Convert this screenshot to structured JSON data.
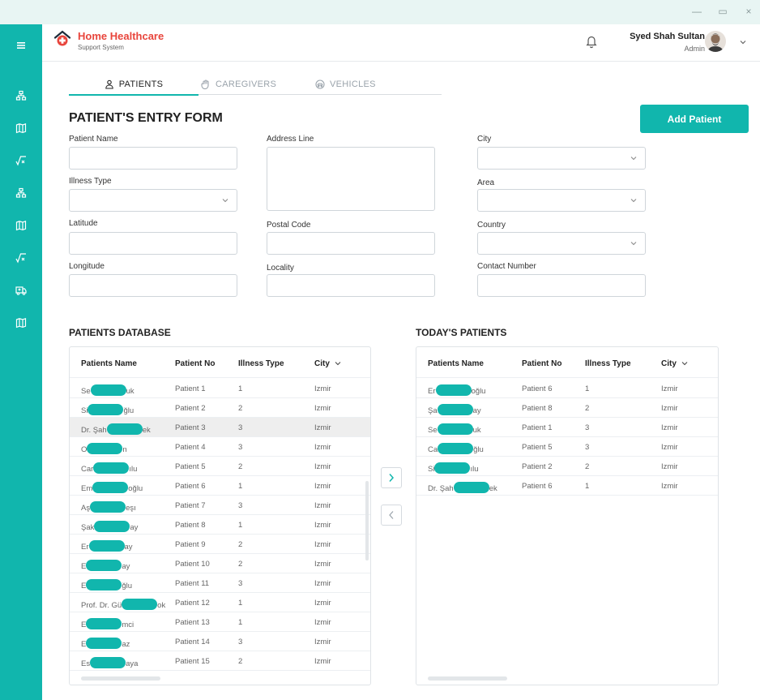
{
  "colors": {
    "accent": "#11b6ad",
    "brand_red": "#e8453c",
    "selected_row": "#eeeeee"
  },
  "window": {
    "controls": [
      "—",
      "▭",
      "×"
    ]
  },
  "header": {
    "brand_title": "Home Healthcare",
    "brand_subtitle": "Support System",
    "user_name": "Syed Shah Sultan",
    "user_role": "Admin"
  },
  "sidebar": {
    "icons": [
      "menu-icon",
      "org-icon",
      "map-icon",
      "formula-icon",
      "org-icon",
      "map-icon",
      "formula-icon",
      "ambulance-icon",
      "map-icon"
    ]
  },
  "tabs": [
    {
      "label": "PATIENTS",
      "icon": "patient-icon",
      "active": true
    },
    {
      "label": "CAREGIVERS",
      "icon": "caregiver-icon",
      "active": false
    },
    {
      "label": "VEHICLES",
      "icon": "vehicle-icon",
      "active": false
    }
  ],
  "form": {
    "title": "PATIENT'S ENTRY FORM",
    "add_button": "Add Patient",
    "patient_name_label": "Patient Name",
    "illness_type_label": "Illness Type",
    "latitude_label": "Latitude",
    "longitude_label": "Longitude",
    "address_label": "Address Line",
    "postal_code_label": "Postal Code",
    "locality_label": "Locality",
    "city_label": "City",
    "area_label": "Area",
    "country_label": "Country",
    "contact_label": "Contact Number"
  },
  "patients_db": {
    "title": "PATIENTS DATABASE",
    "columns": [
      "Patients Name",
      "Patient No",
      "Illness Type",
      "City"
    ],
    "rows": [
      {
        "name_start": "Se",
        "name_end": "uk",
        "no": "Patient 1",
        "illness": "1",
        "city": "Izmir"
      },
      {
        "name_start": "Si",
        "name_end": "ğlu",
        "no": "Patient 2",
        "illness": "2",
        "city": "Izmir"
      },
      {
        "name_start": "Dr. Şah",
        "name_end": "ek",
        "no": "Patient 3",
        "illness": "3",
        "city": "Izmir",
        "selected": true
      },
      {
        "name_start": "O",
        "name_end": "n",
        "no": "Patient 4",
        "illness": "3",
        "city": "Izmir"
      },
      {
        "name_start": "Car",
        "name_end": "ılu",
        "no": "Patient 5",
        "illness": "2",
        "city": "Izmir"
      },
      {
        "name_start": "Em",
        "name_end": "oğlu",
        "no": "Patient 6",
        "illness": "1",
        "city": "Izmir"
      },
      {
        "name_start": "Aş",
        "name_end": "eşı",
        "no": "Patient 7",
        "illness": "3",
        "city": "Izmir"
      },
      {
        "name_start": "Şak",
        "name_end": "ay",
        "no": "Patient 8",
        "illness": "1",
        "city": "Izmir"
      },
      {
        "name_start": "Er",
        "name_end": "ay",
        "no": "Patient 9",
        "illness": "2",
        "city": "Izmir"
      },
      {
        "name_start": "E",
        "name_end": "ay",
        "no": "Patient 10",
        "illness": "2",
        "city": "Izmir"
      },
      {
        "name_start": "E",
        "name_end": "ğlu",
        "no": "Patient 11",
        "illness": "3",
        "city": "Izmir"
      },
      {
        "name_start": "Prof. Dr. Gü",
        "name_end": "ok",
        "no": "Patient 12",
        "illness": "1",
        "city": "Izmir"
      },
      {
        "name_start": "E",
        "name_end": "mci",
        "no": "Patient 13",
        "illness": "1",
        "city": "Izmir"
      },
      {
        "name_start": "E",
        "name_end": "az",
        "no": "Patient 14",
        "illness": "3",
        "city": "Izmir"
      },
      {
        "name_start": "Es",
        "name_end": "aya",
        "no": "Patient 15",
        "illness": "2",
        "city": "Izmir"
      }
    ]
  },
  "todays_patients": {
    "title": "TODAY'S PATIENTS",
    "columns": [
      "Patients Name",
      "Patient No",
      "Illness Type",
      "City"
    ],
    "rows": [
      {
        "name_start": "Er",
        "name_end": "oğlu",
        "no": "Patient 6",
        "illness": "1",
        "city": "Izmir"
      },
      {
        "name_start": "Şa",
        "name_end": "ay",
        "no": "Patient 8",
        "illness": "2",
        "city": "Izmir"
      },
      {
        "name_start": "Se",
        "name_end": "uk",
        "no": "Patient 1",
        "illness": "3",
        "city": "Izmir"
      },
      {
        "name_start": "Ca",
        "name_end": "ğlu",
        "no": "Patient 5",
        "illness": "3",
        "city": "Izmir"
      },
      {
        "name_start": "Si",
        "name_end": "ılu",
        "no": "Patient 2",
        "illness": "2",
        "city": "Izmir"
      },
      {
        "name_start": "Dr. Şah",
        "name_end": "ek",
        "no": "Patient 6",
        "illness": "1",
        "city": "Izmir"
      }
    ]
  }
}
